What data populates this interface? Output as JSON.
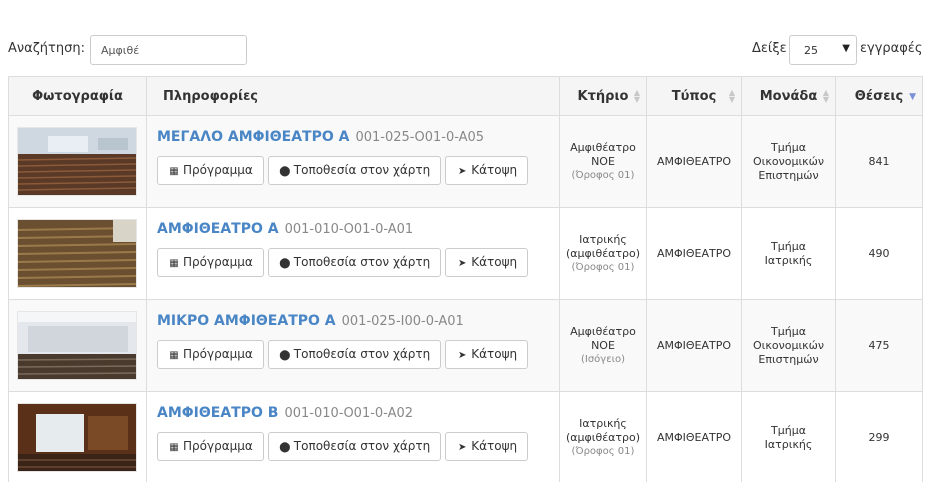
{
  "search": {
    "label": "Αναζήτηση:",
    "value": "Αμφιθέ"
  },
  "length": {
    "show_label": "Δείξε",
    "selected": "25",
    "entries_label": "εγγραφές"
  },
  "table": {
    "headers": {
      "photo": "Φωτογραφία",
      "info": "Πληροφορίες",
      "building": "Κτήριο",
      "type": "Τύπος",
      "unit": "Μονάδα",
      "seats": "Θέσεις"
    },
    "sorted_column": "seats",
    "rows": [
      {
        "name": "ΜΕΓΑΛΟ ΑΜΦΙΘΕΑΤΡΟ Α",
        "code": "001-025-O01-0-A05",
        "btn_schedule": "Πρόγραμμα",
        "btn_map": "Τοποθεσία στον χάρτη",
        "btn_plan": "Κάτοψη",
        "building_1": "Αμφιθέατρο",
        "building_2": "ΝΟΕ",
        "floor": "(Όροφος 01)",
        "type": "ΑΜΦΙΘΕΑΤΡΟ",
        "unit_1": "Τμήμα",
        "unit_2": "Οικονομικών",
        "unit_3": "Επιστημών",
        "seats": "841"
      },
      {
        "name": "ΑΜΦΙΘΕΑΤΡΟ Α",
        "code": "001-010-O01-0-A01",
        "btn_schedule": "Πρόγραμμα",
        "btn_map": "Τοποθεσία στον χάρτη",
        "btn_plan": "Κάτοψη",
        "building_1": "Ιατρικής",
        "building_2": "(αμφιθέατρο)",
        "floor": "(Όροφος 01)",
        "type": "ΑΜΦΙΘΕΑΤΡΟ",
        "unit_1": "Τμήμα",
        "unit_2": "Ιατρικής",
        "unit_3": "",
        "seats": "490"
      },
      {
        "name": "ΜΙΚΡΟ ΑΜΦΙΘΕΑΤΡΟ Α",
        "code": "001-025-I00-0-A01",
        "btn_schedule": "Πρόγραμμα",
        "btn_map": "Τοποθεσία στον χάρτη",
        "btn_plan": "Κάτοψη",
        "building_1": "Αμφιθέατρο",
        "building_2": "ΝΟΕ",
        "floor": "(Ισόγειο)",
        "type": "ΑΜΦΙΘΕΑΤΡΟ",
        "unit_1": "Τμήμα",
        "unit_2": "Οικονομικών",
        "unit_3": "Επιστημών",
        "seats": "475"
      },
      {
        "name": "ΑΜΦΙΘΕΑΤΡΟ Β",
        "code": "001-010-O01-0-A02",
        "btn_schedule": "Πρόγραμμα",
        "btn_map": "Τοποθεσία στον χάρτη",
        "btn_plan": "Κάτοψη",
        "building_1": "Ιατρικής",
        "building_2": "(αμφιθέατρο)",
        "floor": "(Όροφος 01)",
        "type": "ΑΜΦΙΘΕΑΤΡΟ",
        "unit_1": "Τμήμα",
        "unit_2": "Ιατρικής",
        "unit_3": "",
        "seats": "299"
      }
    ]
  },
  "icons": {
    "schedule": "calendar-icon",
    "map": "map-marker-icon",
    "plan": "location-arrow-icon"
  },
  "colors": {
    "link": "#4a86c5",
    "muted": "#888888",
    "sort_active": "#7a8fd6"
  }
}
